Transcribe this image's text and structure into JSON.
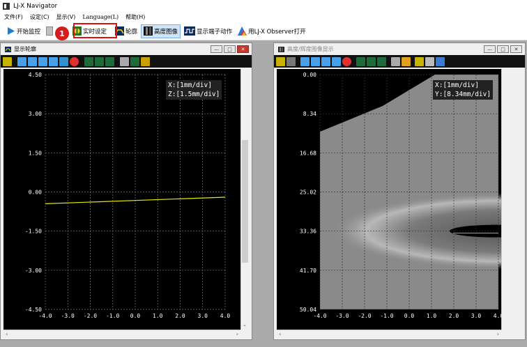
{
  "app": {
    "title": "LJ-X Navigator"
  },
  "menu": [
    "文件(F)",
    "设定(C)",
    "显示(V)",
    "Language(L)",
    "帮助(H)"
  ],
  "toolbar": {
    "start": "开始监控",
    "realtime": "实时设定",
    "profile": "轮廓",
    "height": "高度图像",
    "terminal": "显示端子动作",
    "observer": "用LJ-X Observer打开",
    "badge": "1"
  },
  "profile_window": {
    "title": "显示轮廓",
    "scale_x": "X:[1mm/div]",
    "scale_z": "Z:[1.5mm/div]"
  },
  "height_window": {
    "title": "高度/辉度图像显示",
    "scale_x": "X:[1mm/div]",
    "scale_y": "Y:[8.34mm/div]"
  },
  "chart_data": [
    {
      "type": "line",
      "title": "",
      "xlabel": "",
      "ylabel": "",
      "x_ticks": [
        "-4.0",
        "-3.0",
        "-2.0",
        "-1.0",
        "0.0",
        "1.0",
        "2.0",
        "3.0",
        "4.0"
      ],
      "y_ticks": [
        "4.50",
        "3.00",
        "1.50",
        "0.00",
        "-1.50",
        "-3.00",
        "-4.50"
      ],
      "xlim": [
        -4.0,
        4.0
      ],
      "ylim": [
        -4.5,
        4.5
      ],
      "grid": true,
      "series": [
        {
          "x": [
            -4.0,
            4.0
          ],
          "y": [
            -0.45,
            -0.2
          ],
          "color": "#e8e800"
        }
      ]
    },
    {
      "type": "heatmap",
      "title": "",
      "x_ticks": [
        "-4.0",
        "-3.0",
        "-2.0",
        "-1.0",
        "0.0",
        "1.0",
        "2.0",
        "3.0",
        "4.0"
      ],
      "y_ticks": [
        "0.00",
        "8.34",
        "16.68",
        "25.02",
        "33.36",
        "41.70",
        "50.04"
      ],
      "xlim": [
        -4.0,
        4.0
      ],
      "ylim": [
        0.0,
        50.04
      ],
      "grid": true
    }
  ],
  "colors": {
    "accent": "#d41c1c",
    "line": "#e8e800",
    "workspace": "#ababab"
  }
}
